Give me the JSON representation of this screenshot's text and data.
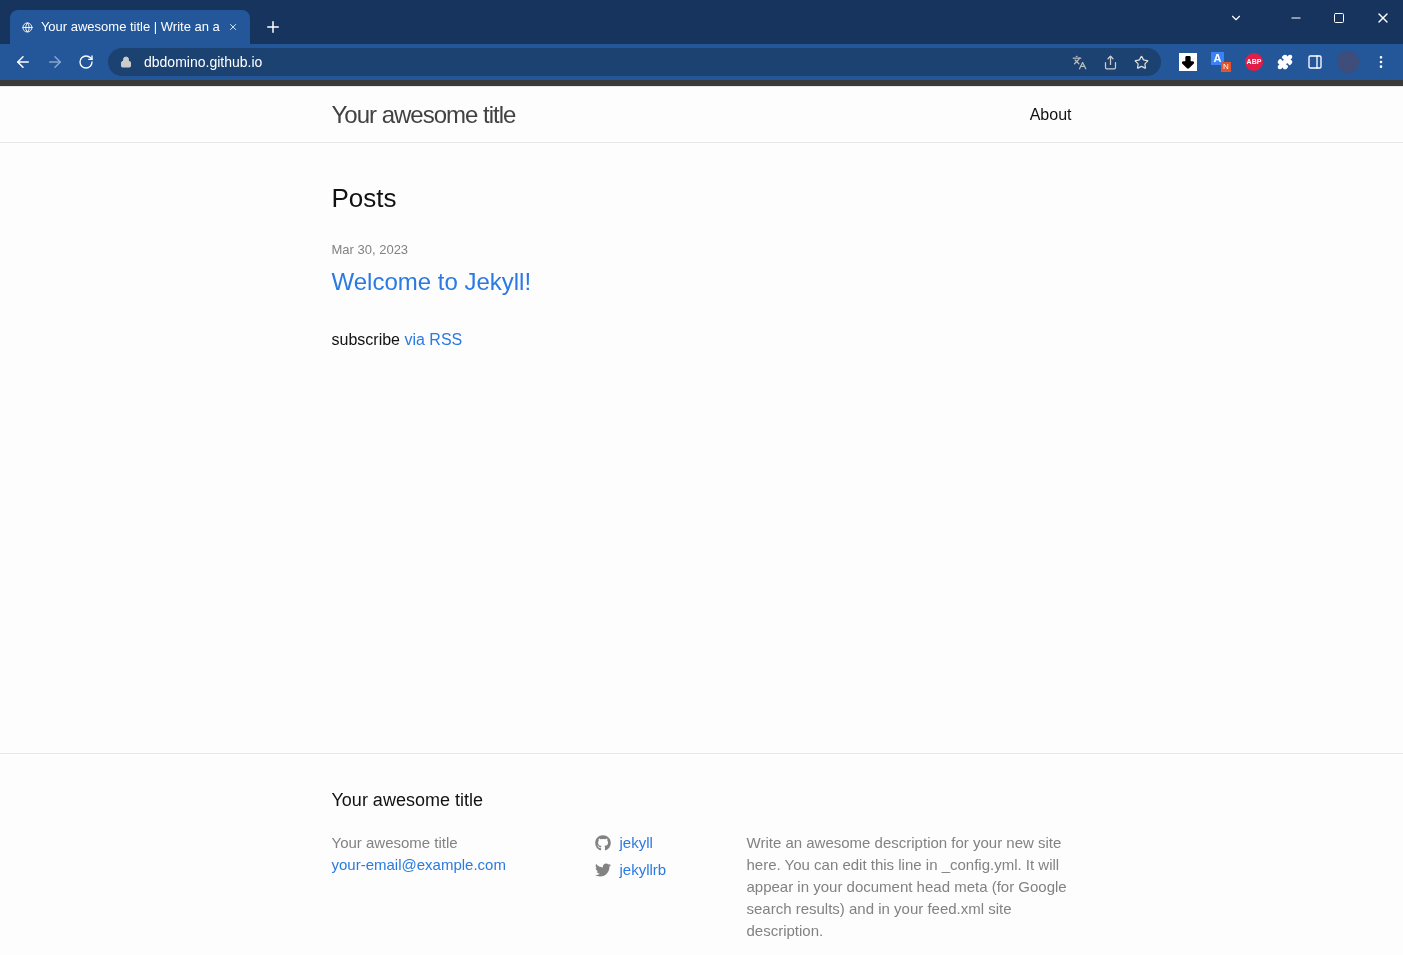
{
  "browser": {
    "tab": {
      "title": "Your awesome title | Write an a",
      "selected": true
    },
    "address": "dbdomino.github.io",
    "extensions": [
      {
        "kind": "download"
      },
      {
        "kind": "translate",
        "label": "A",
        "badge": "N"
      },
      {
        "kind": "adblock",
        "label": "ABP"
      },
      {
        "kind": "puzzle"
      },
      {
        "kind": "sidepanel"
      }
    ]
  },
  "header": {
    "site_title": "Your awesome title",
    "nav": [
      "About"
    ]
  },
  "main": {
    "heading": "Posts",
    "posts": [
      {
        "date": "Mar 30, 2023",
        "title": "Welcome to Jekyll!"
      }
    ],
    "subscribe": {
      "text": "subscribe",
      "link": "via RSS"
    }
  },
  "footer": {
    "title": "Your awesome title",
    "name": "Your awesome title",
    "email": "your-email@example.com",
    "social": [
      {
        "kind": "github",
        "label": "jekyll"
      },
      {
        "kind": "twitter",
        "label": "jekyllrb"
      }
    ],
    "description": "Write an awesome description for your new site here. You can edit this line in _config.yml. It will appear in your document head meta (for Google search results) and in your feed.xml site description."
  }
}
